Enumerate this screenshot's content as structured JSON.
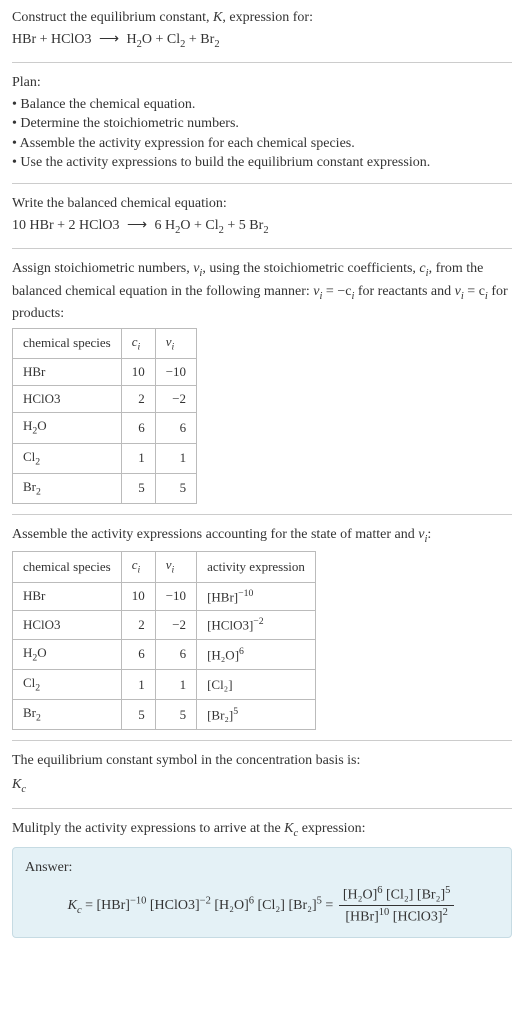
{
  "intro": {
    "line1": "Construct the equilibrium constant, ",
    "K": "K",
    "line1b": ", expression for:",
    "eqn_lhs": "HBr + HClO3",
    "arrow": "⟶",
    "eqn_rhs_a": "H",
    "eqn_rhs_a2": "2",
    "eqn_rhs_b": "O + Cl",
    "eqn_rhs_b2": "2",
    "eqn_rhs_c": " + Br",
    "eqn_rhs_c2": "2"
  },
  "plan": {
    "title": "Plan:",
    "items": [
      "Balance the chemical equation.",
      "Determine the stoichiometric numbers.",
      "Assemble the activity expression for each chemical species.",
      "Use the activity expressions to build the equilibrium constant expression."
    ]
  },
  "balance": {
    "title": "Write the balanced chemical equation:",
    "lhs": "10 HBr + 2 HClO3",
    "arrow": "⟶",
    "rhs_a": "6 H",
    "rhs_a2": "2",
    "rhs_b": "O + Cl",
    "rhs_b2": "2",
    "rhs_c": " + 5 Br",
    "rhs_c2": "2"
  },
  "assign": {
    "text_a": "Assign stoichiometric numbers, ",
    "nu": "ν",
    "sub_i": "i",
    "text_b": ", using the stoichiometric coefficients, ",
    "c": "c",
    "text_c": ", from the balanced chemical equation in the following manner: ",
    "eq1_l": "ν",
    "eq1_r": " = −c",
    "text_d": " for reactants and ",
    "eq2_l": "ν",
    "eq2_r": " = c",
    "text_e": " for products:"
  },
  "table1": {
    "headers": [
      "chemical species",
      "cᵢ",
      "νᵢ"
    ],
    "rows": [
      {
        "sp_a": "HBr",
        "sp_b": "",
        "c": "10",
        "v": "−10"
      },
      {
        "sp_a": "HClO3",
        "sp_b": "",
        "c": "2",
        "v": "−2"
      },
      {
        "sp_a": "H",
        "sp_sub": "2",
        "sp_b": "O",
        "c": "6",
        "v": "6"
      },
      {
        "sp_a": "Cl",
        "sp_sub": "2",
        "sp_b": "",
        "c": "1",
        "v": "1"
      },
      {
        "sp_a": "Br",
        "sp_sub": "2",
        "sp_b": "",
        "c": "5",
        "v": "5"
      }
    ]
  },
  "assemble": {
    "text_a": "Assemble the activity expressions accounting for the state of matter and ",
    "nu": "ν",
    "sub_i": "i",
    "colon": ":"
  },
  "table2": {
    "headers": [
      "chemical species",
      "cᵢ",
      "νᵢ",
      "activity expression"
    ],
    "rows": [
      {
        "sp_a": "HBr",
        "sp_b": "",
        "c": "10",
        "v": "−10",
        "act_base": "[HBr]",
        "act_exp": "−10"
      },
      {
        "sp_a": "HClO3",
        "sp_b": "",
        "c": "2",
        "v": "−2",
        "act_base": "[HClO3]",
        "act_exp": "−2"
      },
      {
        "sp_a": "H",
        "sp_sub": "2",
        "sp_b": "O",
        "c": "6",
        "v": "6",
        "act_base": "[H₂O]",
        "act_exp": "6"
      },
      {
        "sp_a": "Cl",
        "sp_sub": "2",
        "sp_b": "",
        "c": "1",
        "v": "1",
        "act_base": "[Cl₂]",
        "act_exp": ""
      },
      {
        "sp_a": "Br",
        "sp_sub": "2",
        "sp_b": "",
        "c": "5",
        "v": "5",
        "act_base": "[Br₂]",
        "act_exp": "5"
      }
    ]
  },
  "kc_basis": {
    "text": "The equilibrium constant symbol in the concentration basis is:",
    "K": "K",
    "sub": "c"
  },
  "multiply": {
    "text_a": "Mulitply the activity expressions to arrive at the ",
    "K": "K",
    "sub": "c",
    "text_b": " expression:"
  },
  "answer": {
    "label": "Answer:",
    "K": "K",
    "sub": "c",
    "eq": " = ",
    "t1": "[HBr]",
    "e1": "−10",
    "t2": " [HClO3]",
    "e2": "−2",
    "t3": " [H₂O]",
    "e3": "6",
    "t4": " [Cl₂] [Br₂]",
    "e4": "5",
    "eq2": " = ",
    "num_a": "[H₂O]",
    "num_ae": "6",
    "num_b": " [Cl₂] [Br₂]",
    "num_be": "5",
    "den_a": "[HBr]",
    "den_ae": "10",
    "den_b": " [HClO3]",
    "den_be": "2"
  }
}
